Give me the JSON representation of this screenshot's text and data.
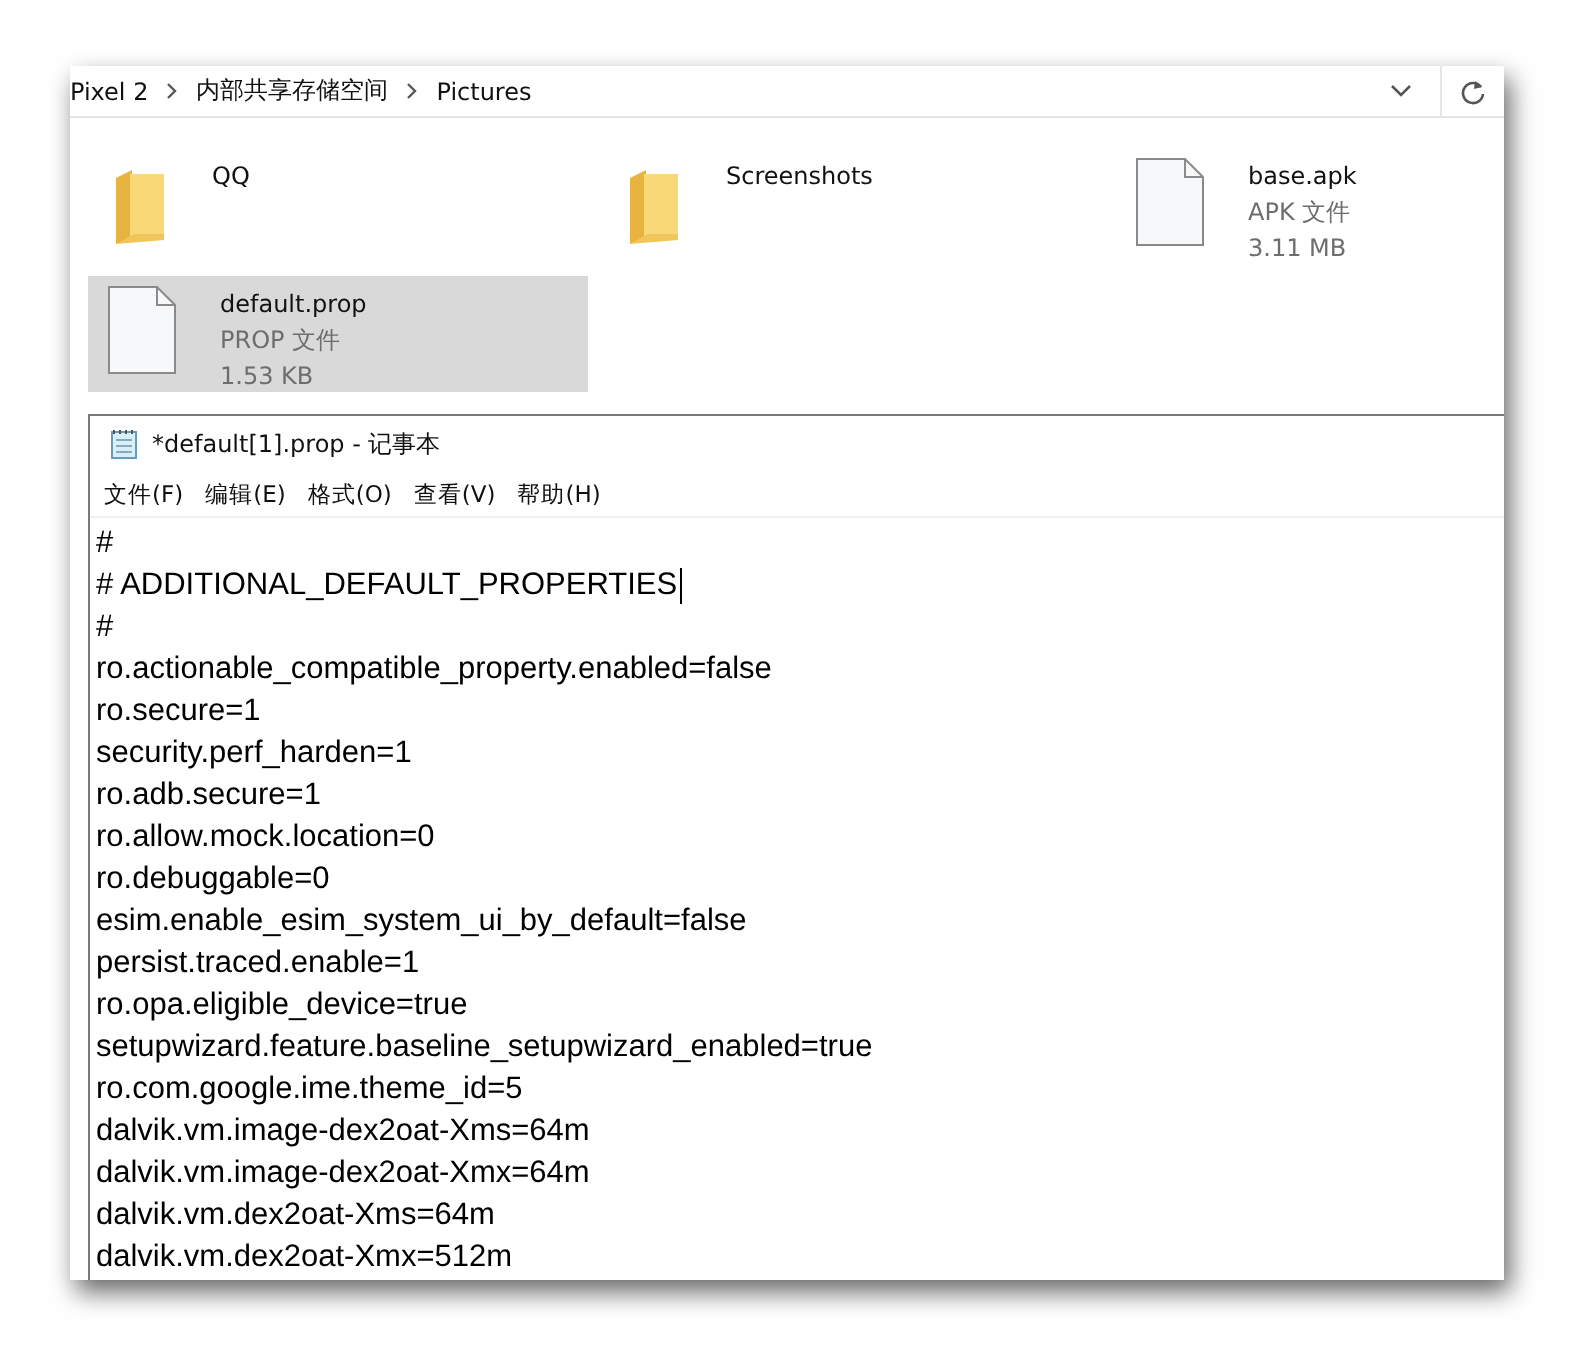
{
  "explorer": {
    "breadcrumb": [
      "Pixel 2",
      "内部共享存储空间",
      "Pictures"
    ],
    "items": [
      {
        "kind": "folder",
        "name": "QQ",
        "selected": false
      },
      {
        "kind": "folder",
        "name": "Screenshots",
        "selected": false
      },
      {
        "kind": "file",
        "name": "base.apk",
        "type": "APK 文件",
        "size": "3.11 MB",
        "selected": false
      },
      {
        "kind": "file",
        "name": "default.prop",
        "type": "PROP 文件",
        "size": "1.53 KB",
        "selected": true
      }
    ]
  },
  "notepad": {
    "title": "*default[1].prop - 记事本",
    "menu": [
      "文件(F)",
      "编辑(E)",
      "格式(O)",
      "查看(V)",
      "帮助(H)"
    ],
    "lines": [
      {
        "text": "#",
        "cursor": false
      },
      {
        "text": "# ADDITIONAL_DEFAULT_PROPERTIES",
        "cursor": true
      },
      {
        "text": "#",
        "cursor": false
      },
      {
        "text": "ro.actionable_compatible_property.enabled=false",
        "cursor": false
      },
      {
        "text": "ro.secure=1",
        "cursor": false
      },
      {
        "text": "security.perf_harden=1",
        "cursor": false
      },
      {
        "text": "ro.adb.secure=1",
        "cursor": false
      },
      {
        "text": "ro.allow.mock.location=0",
        "cursor": false
      },
      {
        "text": "ro.debuggable=0",
        "cursor": false
      },
      {
        "text": "esim.enable_esim_system_ui_by_default=false",
        "cursor": false
      },
      {
        "text": "persist.traced.enable=1",
        "cursor": false
      },
      {
        "text": "ro.opa.eligible_device=true",
        "cursor": false
      },
      {
        "text": "setupwizard.feature.baseline_setupwizard_enabled=true",
        "cursor": false
      },
      {
        "text": "ro.com.google.ime.theme_id=5",
        "cursor": false
      },
      {
        "text": "dalvik.vm.image-dex2oat-Xms=64m",
        "cursor": false
      },
      {
        "text": "dalvik.vm.image-dex2oat-Xmx=64m",
        "cursor": false
      },
      {
        "text": "dalvik.vm.dex2oat-Xms=64m",
        "cursor": false
      },
      {
        "text": "dalvik.vm.dex2oat-Xmx=512m",
        "cursor": false
      }
    ]
  }
}
